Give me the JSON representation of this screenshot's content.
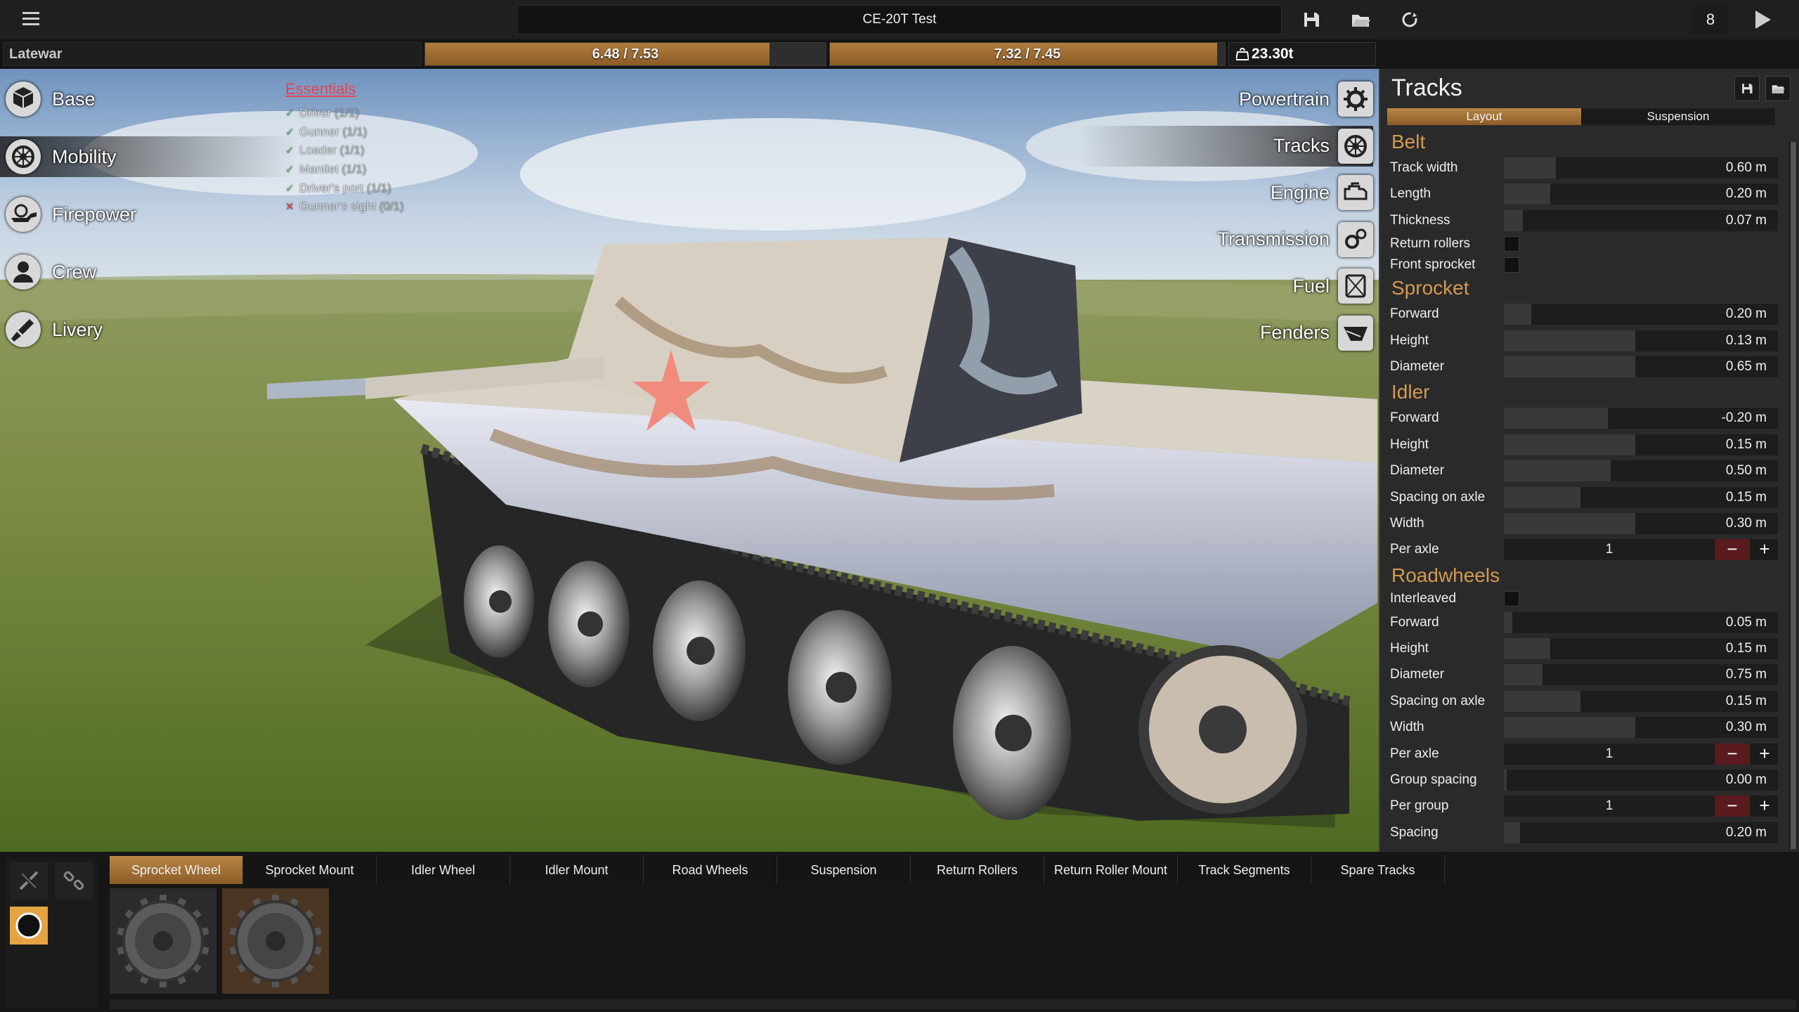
{
  "topbar": {
    "menu_icon": "hamburger-menu-icon",
    "title_value": "CE-20T Test",
    "actions": [
      {
        "icon": "save-icon"
      },
      {
        "icon": "open-folder-icon"
      },
      {
        "icon": "reset-icon"
      }
    ],
    "count": "8",
    "play_icon": "play-icon"
  },
  "statbar": {
    "vehicle_name": "Latewar",
    "gauge_1": {
      "label": "6.48 / 7.53",
      "fraction": 0.86
    },
    "gauge_2": {
      "label": "7.32 / 7.45",
      "fraction": 0.98
    },
    "weight": "23.30t",
    "weight_icon": "weight-icon"
  },
  "left_categories": [
    {
      "label": "Base",
      "icon": "cube-icon",
      "active": false
    },
    {
      "label": "Mobility",
      "icon": "wheel-icon",
      "active": true
    },
    {
      "label": "Firepower",
      "icon": "gun-icon",
      "active": false
    },
    {
      "label": "Crew",
      "icon": "person-icon",
      "active": false
    },
    {
      "label": "Livery",
      "icon": "paint-brush-icon",
      "active": false
    }
  ],
  "essentials": {
    "title": "Essentials",
    "items": [
      {
        "mark": "✓",
        "label": "Driver",
        "count": "(1/1)",
        "ok": true
      },
      {
        "mark": "✓",
        "label": "Gunner",
        "count": "(1/1)",
        "ok": true
      },
      {
        "mark": "✓",
        "label": "Loader",
        "count": "(1/1)",
        "ok": true
      },
      {
        "mark": "✓",
        "label": "Mantlet",
        "count": "(1/1)",
        "ok": true
      },
      {
        "mark": "✓",
        "label": "Driver's port",
        "count": "(1/1)",
        "ok": true
      },
      {
        "mark": "✕",
        "label": "Gunner's sight",
        "count": "(0/1)",
        "ok": false
      }
    ]
  },
  "right_categories": [
    {
      "label": "Powertrain",
      "icon": "gear-icon",
      "active": false
    },
    {
      "label": "Tracks",
      "icon": "wheel-icon",
      "active": true
    },
    {
      "label": "Engine",
      "icon": "engine-icon",
      "active": false
    },
    {
      "label": "Transmission",
      "icon": "gears-icon",
      "active": false
    },
    {
      "label": "Fuel",
      "icon": "fuel-icon",
      "active": false
    },
    {
      "label": "Fenders",
      "icon": "fender-icon",
      "active": false
    }
  ],
  "panel": {
    "title": "Tracks",
    "tabs": [
      "Layout",
      "Suspension"
    ],
    "active_tab": 0,
    "belt": {
      "title": "Belt",
      "track_width": {
        "label": "Track width",
        "value": "0.60 m",
        "fraction": 0.19
      },
      "length": {
        "label": "Length",
        "value": "0.20 m",
        "fraction": 0.17
      },
      "thickness": {
        "label": "Thickness",
        "value": "0.07 m",
        "fraction": 0.07
      },
      "return_rollers": {
        "label": "Return rollers",
        "checked": false
      },
      "front_sprocket": {
        "label": "Front sprocket",
        "checked": false
      }
    },
    "sprocket": {
      "title": "Sprocket",
      "forward": {
        "label": "Forward",
        "value": "0.20 m",
        "fraction": 0.1
      },
      "height": {
        "label": "Height",
        "value": "0.13 m",
        "fraction": 0.48
      },
      "diameter": {
        "label": "Diameter",
        "value": "0.65 m",
        "fraction": 0.48
      }
    },
    "idler": {
      "title": "Idler",
      "forward": {
        "label": "Forward",
        "value": "-0.20 m",
        "fraction": 0.38
      },
      "height": {
        "label": "Height",
        "value": "0.15 m",
        "fraction": 0.48
      },
      "diameter": {
        "label": "Diameter",
        "value": "0.50 m",
        "fraction": 0.39
      },
      "spacing_on_axle": {
        "label": "Spacing on axle",
        "value": "0.15 m",
        "fraction": 0.28
      },
      "width": {
        "label": "Width",
        "value": "0.30 m",
        "fraction": 0.48
      },
      "per_axle": {
        "label": "Per axle",
        "value": "1"
      }
    },
    "roadwheels": {
      "title": "Roadwheels",
      "interleaved": {
        "label": "Interleaved",
        "checked": false
      },
      "forward": {
        "label": "Forward",
        "value": "0.05 m",
        "fraction": 0.03
      },
      "height": {
        "label": "Height",
        "value": "0.15 m",
        "fraction": 0.17
      },
      "diameter": {
        "label": "Diameter",
        "value": "0.75 m",
        "fraction": 0.14
      },
      "spacing_on_axle": {
        "label": "Spacing on axle",
        "value": "0.15 m",
        "fraction": 0.28
      },
      "width": {
        "label": "Width",
        "value": "0.30 m",
        "fraction": 0.48
      },
      "per_axle": {
        "label": "Per axle",
        "value": "1"
      },
      "group_spacing": {
        "label": "Group spacing",
        "value": "0.00 m",
        "fraction": 0.01
      },
      "per_group": {
        "label": "Per group",
        "value": "1"
      },
      "spacing": {
        "label": "Spacing",
        "value": "0.20 m",
        "fraction": 0.06
      }
    },
    "stepper_minus": "−",
    "stepper_plus": "+"
  },
  "bottom": {
    "tool_icons": [
      "disconnect-icon",
      "connect-icon",
      "circle-tool-icon"
    ],
    "part_tabs": [
      "Sprocket Wheel",
      "Sprocket Mount",
      "Idler Wheel",
      "Idler Mount",
      "Road Wheels",
      "Suspension",
      "Return Rollers",
      "Return Roller Mount",
      "Track Segments",
      "Spare Tracks"
    ],
    "active_part_tab": 0,
    "thumbnails": [
      {
        "icon": "sprocket-wheel-icon",
        "selected": false
      },
      {
        "icon": "sprocket-wheel-icon",
        "selected": true
      }
    ]
  }
}
